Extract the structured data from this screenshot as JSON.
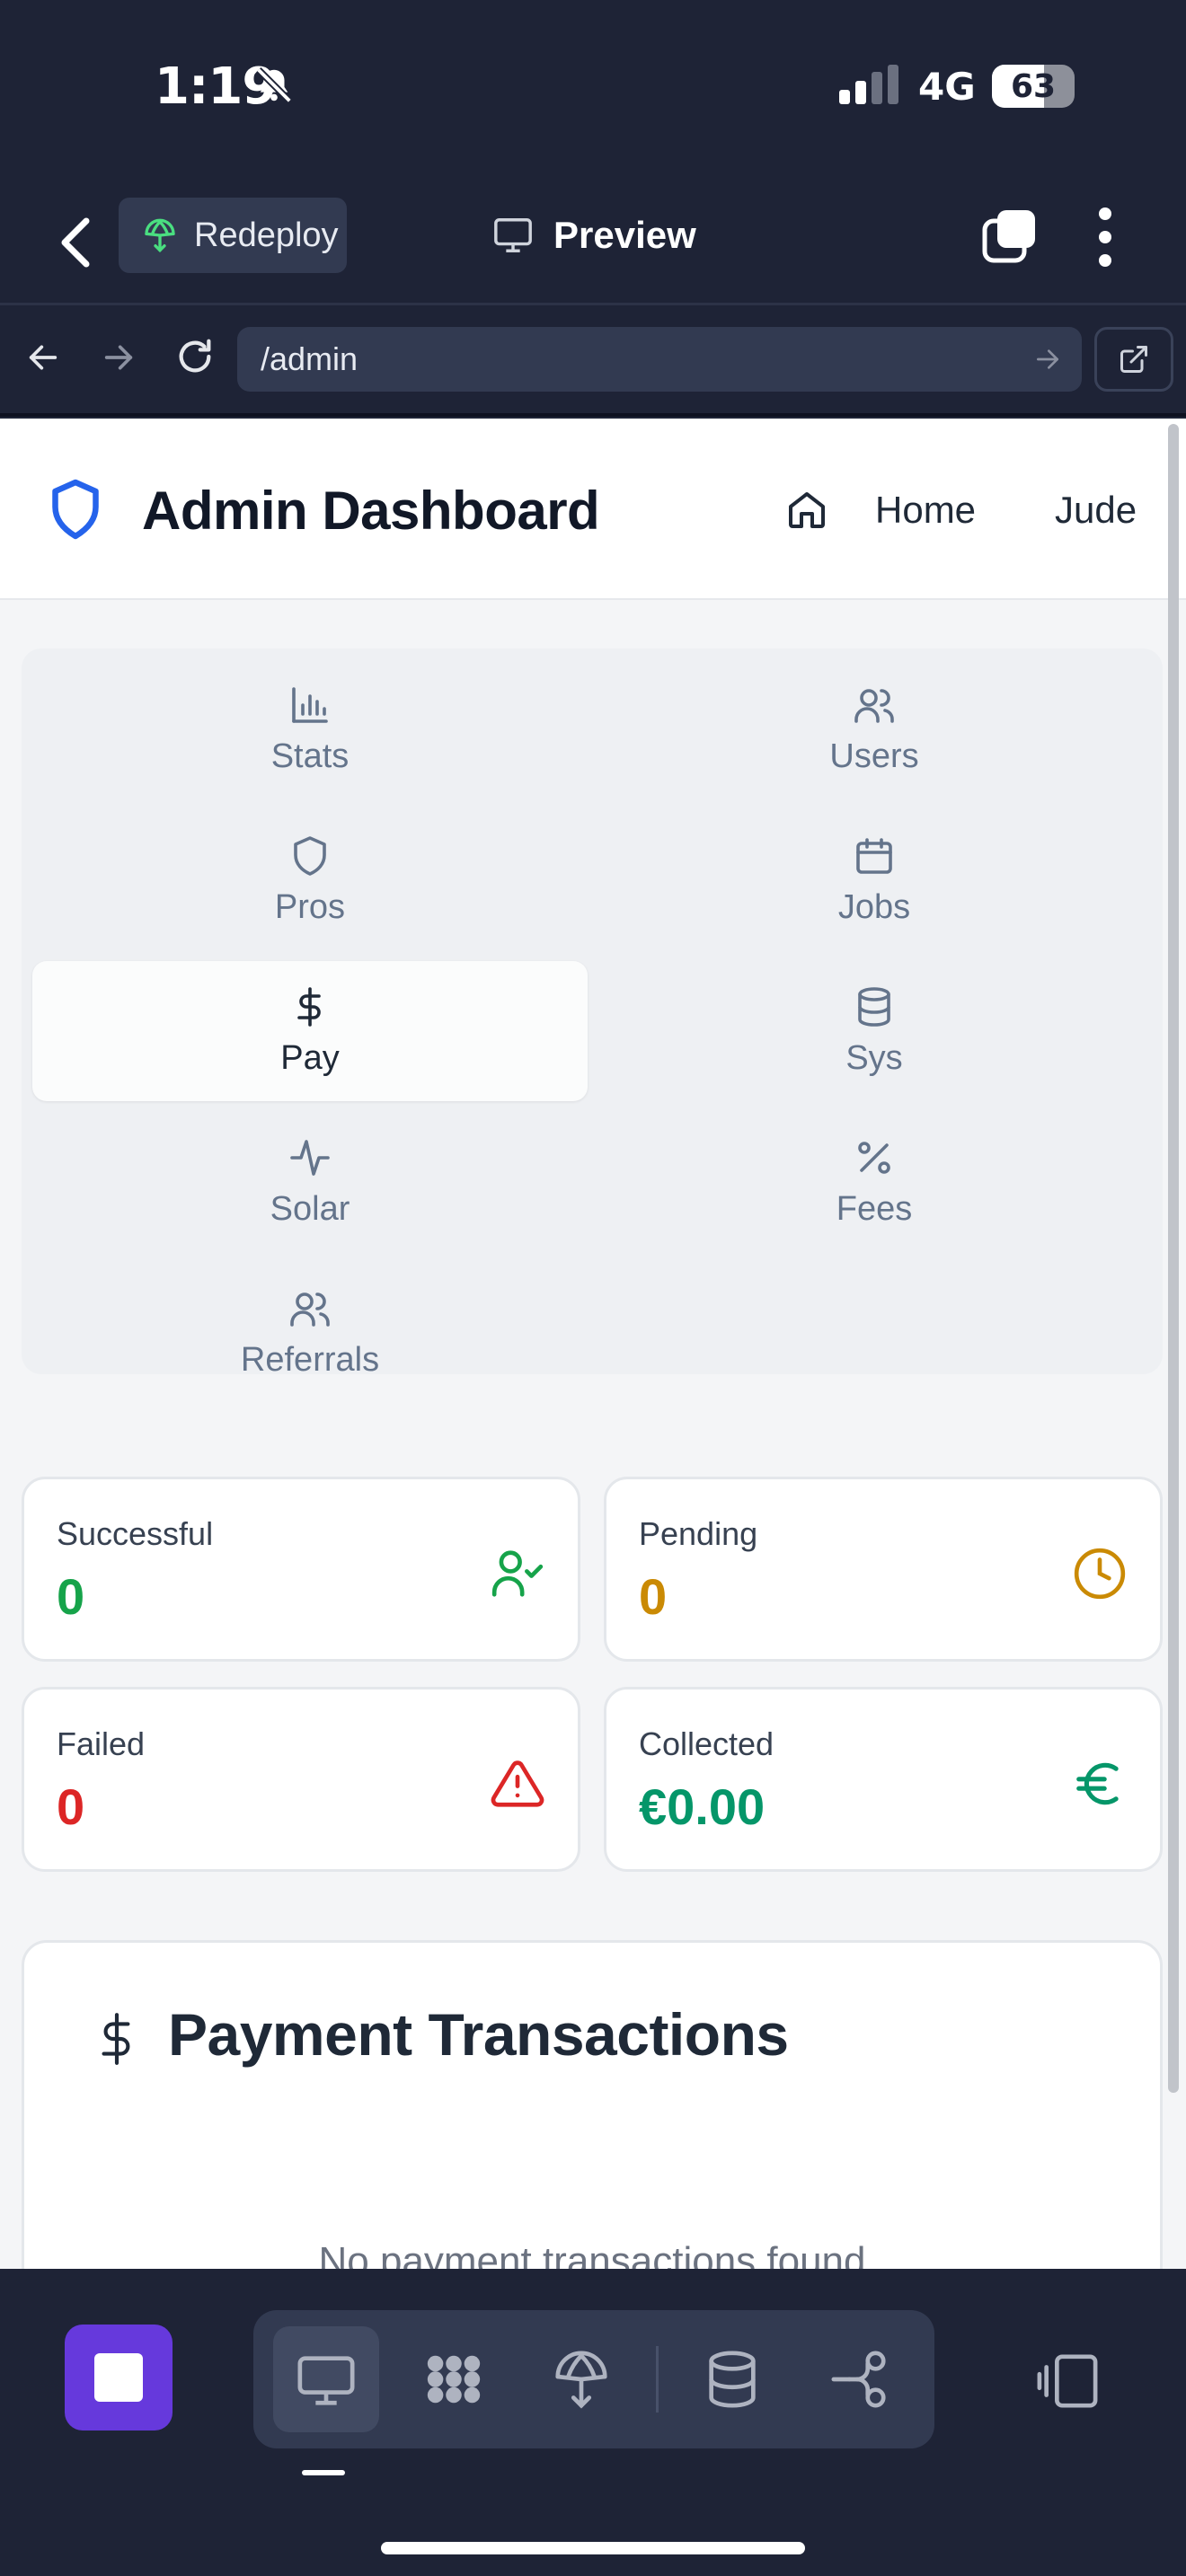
{
  "status_bar": {
    "time": "1:19",
    "network": "4G",
    "battery_percent": "63",
    "battery_level": 0.63,
    "silent_icon": "bell-slash-icon",
    "signal_icon": "cellular-signal-icon"
  },
  "app_bar": {
    "redeploy_label": "Redeploy",
    "preview_label": "Preview"
  },
  "browser": {
    "url": "/admin"
  },
  "header": {
    "title": "Admin Dashboard",
    "home_label": "Home",
    "user_label": "Jude"
  },
  "admin_nav": {
    "items": [
      {
        "label": "Stats",
        "icon": "bar-chart-icon"
      },
      {
        "label": "Users",
        "icon": "users-icon"
      },
      {
        "label": "Pros",
        "icon": "shield-icon"
      },
      {
        "label": "Jobs",
        "icon": "calendar-icon"
      },
      {
        "label": "Pay",
        "icon": "dollar-icon",
        "active": true
      },
      {
        "label": "Sys",
        "icon": "database-icon"
      },
      {
        "label": "Solar",
        "icon": "activity-icon"
      },
      {
        "label": "Fees",
        "icon": "percent-icon"
      },
      {
        "label": "Referrals",
        "icon": "users-icon"
      }
    ]
  },
  "stats": {
    "successful": {
      "label": "Successful",
      "value": "0",
      "color": "#16a34a",
      "icon": "user-check-icon"
    },
    "pending": {
      "label": "Pending",
      "value": "0",
      "color": "#ca8a04",
      "icon": "clock-icon"
    },
    "failed": {
      "label": "Failed",
      "value": "0",
      "color": "#dc2626",
      "icon": "alert-triangle-icon"
    },
    "collected": {
      "label": "Collected",
      "value": "€0.00",
      "color": "#059669",
      "icon": "euro-icon"
    }
  },
  "transactions": {
    "title": "Payment Transactions",
    "empty_text": "No payment transactions found"
  },
  "colors": {
    "accent": "#2563eb",
    "dark_bg": "#1e2336",
    "stop_button": "#6639dc"
  }
}
